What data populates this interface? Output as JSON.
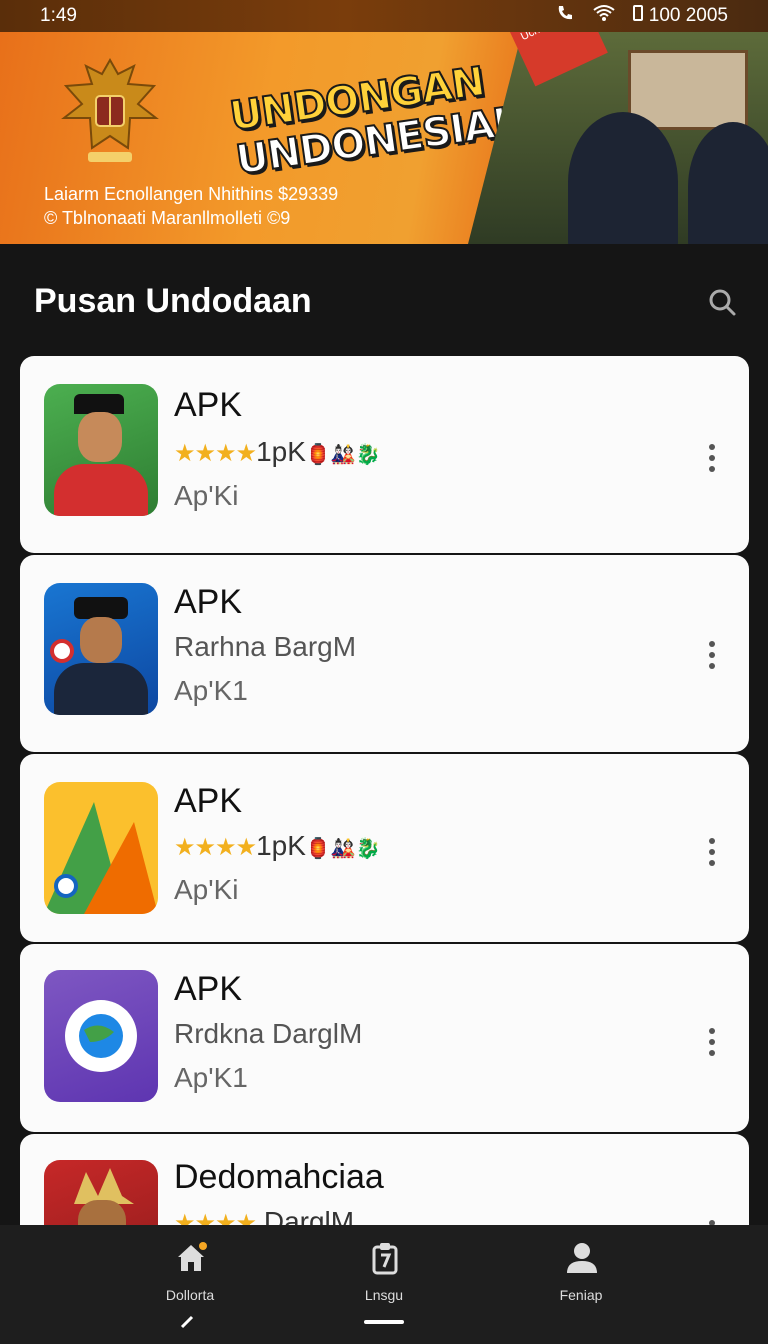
{
  "status": {
    "time": "1:49",
    "battery": "100 2005"
  },
  "banner": {
    "title_line1": "UNDONGAN",
    "title_line2": "UNDONESIAI",
    "sub_line1": "Laiarm Ecnollangen Nhithins $29339",
    "sub_line2": "© Tblnonaati Maranllmolleti ©9",
    "ribbon": "Ucnmsia"
  },
  "header": {
    "title": "Pusan Undodaan"
  },
  "apps": [
    {
      "name": "APK",
      "rating_stars": "★★★★",
      "line2": "1pK",
      "badge": "🏮🎎🐉",
      "line3": "Ap'Ki",
      "icon": "red-uniform-portrait-icon"
    },
    {
      "name": "APK",
      "line2": "Rarhna BargM",
      "line3": "Ap'K1",
      "icon": "navy-uniform-portrait-icon"
    },
    {
      "name": "APK",
      "rating_stars": "★★★★",
      "line2": "1pK",
      "badge": "🏮🎎🐉",
      "line3": "Ap'Ki",
      "icon": "triangle-logo-icon"
    },
    {
      "name": "APK",
      "line2": "Rrdkna DarglM",
      "line3": "Ap'K1",
      "icon": "purple-globe-icon"
    },
    {
      "name": "Dedomahciaa",
      "rating_stars": "★★★★",
      "line2": "DarglM",
      "icon": "crown-portrait-icon"
    }
  ],
  "nav": [
    {
      "label": "Dollorta",
      "icon": "home-icon"
    },
    {
      "label": "Lnsgu",
      "icon": "clipboard-icon"
    },
    {
      "label": "Feniap",
      "icon": "person-icon"
    }
  ],
  "colors": {
    "banner_orange": "#f39a2a",
    "title_yellow": "#ffd23a",
    "star": "#f2b01e",
    "nav_badge": "#f5a623"
  }
}
